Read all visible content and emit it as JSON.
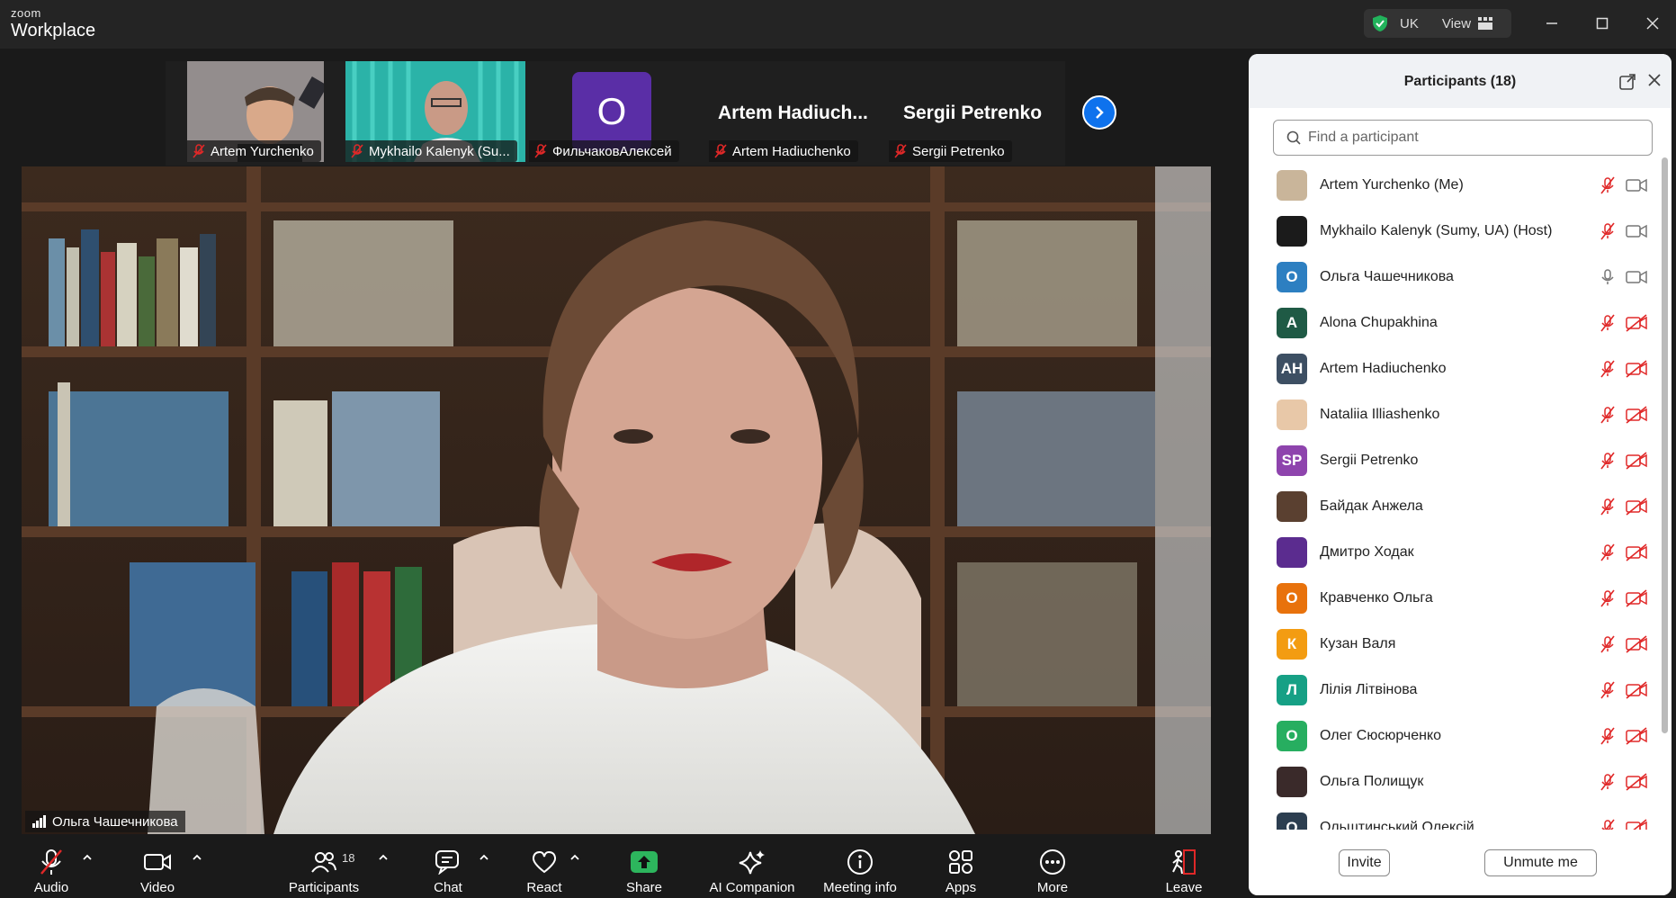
{
  "app": {
    "brand_small": "zoom",
    "brand_big": "Workplace"
  },
  "titlebar": {
    "region": "UK",
    "view_label": "View"
  },
  "strip": {
    "thumbs": [
      {
        "label": "Artem Yurchenko"
      },
      {
        "label": "Mykhailo Kalenyk (Su..."
      },
      {
        "initial": "О",
        "label": "ФильчаковАлексей"
      },
      {
        "big_name": "Artem  Hadiuch...",
        "label": "Artem Hadiuchenko"
      },
      {
        "big_name": "Sergii Petrenko",
        "label": "Sergii Petrenko"
      }
    ]
  },
  "main_video": {
    "speaker": "Ольга Чашечникова"
  },
  "toolbar": {
    "audio": "Audio",
    "video": "Video",
    "participants": "Participants",
    "participants_count": "18",
    "chat": "Chat",
    "react": "React",
    "share": "Share",
    "ai_companion": "AI Companion",
    "meeting_info": "Meeting info",
    "apps": "Apps",
    "more": "More",
    "leave": "Leave"
  },
  "panel": {
    "title": "Participants (18)",
    "search_placeholder": "Find a participant",
    "participants": [
      {
        "name": "Artem Yurchenko (Me)",
        "avatar": "",
        "color": "#c9b59a",
        "mic": "muted",
        "cam": "on"
      },
      {
        "name": "Mykhailo Kalenyk (Sumy, UA) (Host)",
        "avatar": "",
        "color": "#1b1b1b",
        "mic": "muted",
        "cam": "on"
      },
      {
        "name": "Ольга Чашечникова",
        "avatar": "О",
        "color": "#2d7fc1",
        "mic": "on",
        "cam": "on"
      },
      {
        "name": "Alona Chupakhina",
        "avatar": "A",
        "color": "#1f5a45",
        "mic": "muted",
        "cam": "off"
      },
      {
        "name": "Artem Hadiuchenko",
        "avatar": "AH",
        "color": "#3d4f63",
        "mic": "muted",
        "cam": "off"
      },
      {
        "name": "Nataliia Illiashenko",
        "avatar": "",
        "color": "#e8c8a8",
        "mic": "muted",
        "cam": "off"
      },
      {
        "name": "Sergii Petrenko",
        "avatar": "SP",
        "color": "#8e44ad",
        "mic": "muted",
        "cam": "off"
      },
      {
        "name": "Байдак Анжела",
        "avatar": "",
        "color": "#5a4030",
        "mic": "muted",
        "cam": "off"
      },
      {
        "name": "Дмитро Ходак",
        "avatar": "",
        "color": "#5b2c8f",
        "mic": "muted",
        "cam": "off"
      },
      {
        "name": "Кравченко Ольга",
        "avatar": "О",
        "color": "#e8720c",
        "mic": "muted",
        "cam": "off"
      },
      {
        "name": "Кузан Валя",
        "avatar": "К",
        "color": "#f39c12",
        "mic": "muted",
        "cam": "off"
      },
      {
        "name": "Лілія Літвінова",
        "avatar": "Л",
        "color": "#16a085",
        "mic": "muted",
        "cam": "off"
      },
      {
        "name": "Олег Сюсюрченко",
        "avatar": "О",
        "color": "#27ae60",
        "mic": "muted",
        "cam": "off"
      },
      {
        "name": "Ольга Полищук",
        "avatar": "",
        "color": "#3a2a2a",
        "mic": "muted",
        "cam": "off"
      },
      {
        "name": "Ольштинський Олексій",
        "avatar": "О",
        "color": "#2c3e50",
        "mic": "muted",
        "cam": "off"
      }
    ],
    "invite_label": "Invite",
    "unmute_label": "Unmute me"
  },
  "colors": {
    "accent": "#0e72ed",
    "muted_red": "#e02828",
    "share_green": "#2db55d",
    "shield_green": "#22b35c"
  }
}
